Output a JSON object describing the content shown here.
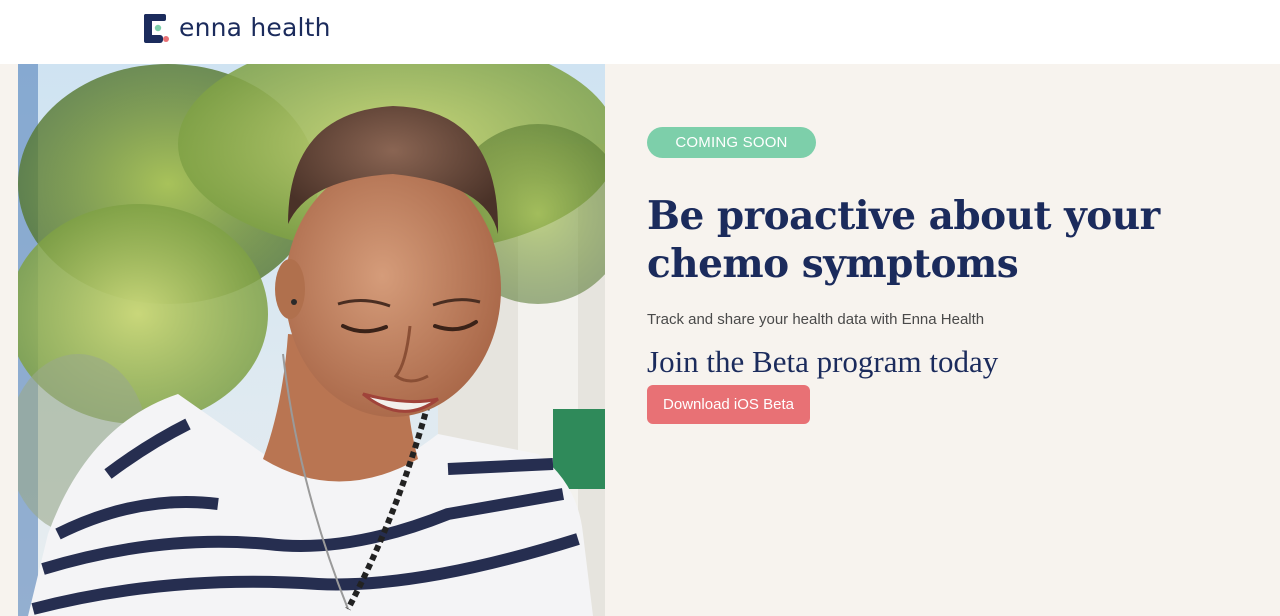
{
  "brand": {
    "name": "enna health",
    "colors": {
      "navy": "#1b2b5c",
      "coral": "#e87175",
      "mint": "#7dcfaa",
      "cream": "#f7f3ee"
    }
  },
  "hero": {
    "badge": "COMING SOON",
    "headline": "Be proactive about your chemo symptoms",
    "subtext": "Track and share your health data with Enna Health",
    "beta_heading": "Join the Beta program today",
    "cta_label": "Download iOS Beta",
    "image_icon": "hero-photo-woman-smiling"
  }
}
